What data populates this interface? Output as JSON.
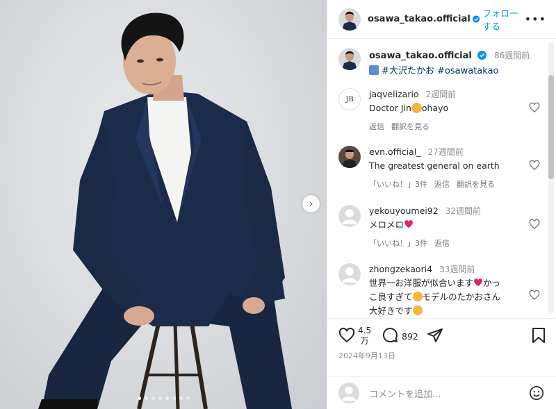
{
  "post": {
    "username": "osawa_takao.official",
    "follow_label": "フォローする",
    "more_label": "•••",
    "caption_time": "86週間前",
    "caption_tags": "#大沢たかお #osawatakao"
  },
  "comments": [
    {
      "user": "jaqvelizario",
      "time": "2週間前",
      "text": "Doctor Jin",
      "text2": "ohayo",
      "emoji": "clapping-hands-icon",
      "actions": [
        "返信",
        "翻訳を見る"
      ]
    },
    {
      "user": "evn.official_",
      "time": "27週間前",
      "text": "The greatest general on earth",
      "actions": [
        "「いいね！」3件",
        "返信",
        "翻訳を見る"
      ]
    },
    {
      "user": "yekouyoumei92",
      "time": "32週間前",
      "text": "メロメロ",
      "emoji": "red-heart-icon",
      "actions": [
        "「いいね！」3件",
        "返信"
      ]
    },
    {
      "user": "zhongzekaori4",
      "time": "33週間前",
      "text": "世界一お洋服が似合います",
      "text_b": "かっ",
      "text_c": "こ良すぎて",
      "text_d": "モデルのたかおさん",
      "text_e": "大好きです",
      "actions": []
    }
  ],
  "stats": {
    "likes_top": "4.5",
    "likes_unit": "万",
    "comments_count": "892",
    "date": "2024年9月13日"
  },
  "add_comment": {
    "placeholder": "コメントを追加..."
  },
  "colors": {
    "accent": "#0095f6",
    "heart_red": "#e0245e",
    "suit_navy": "#1c2b4a"
  },
  "carousel": {
    "total": 8,
    "active": 0
  }
}
